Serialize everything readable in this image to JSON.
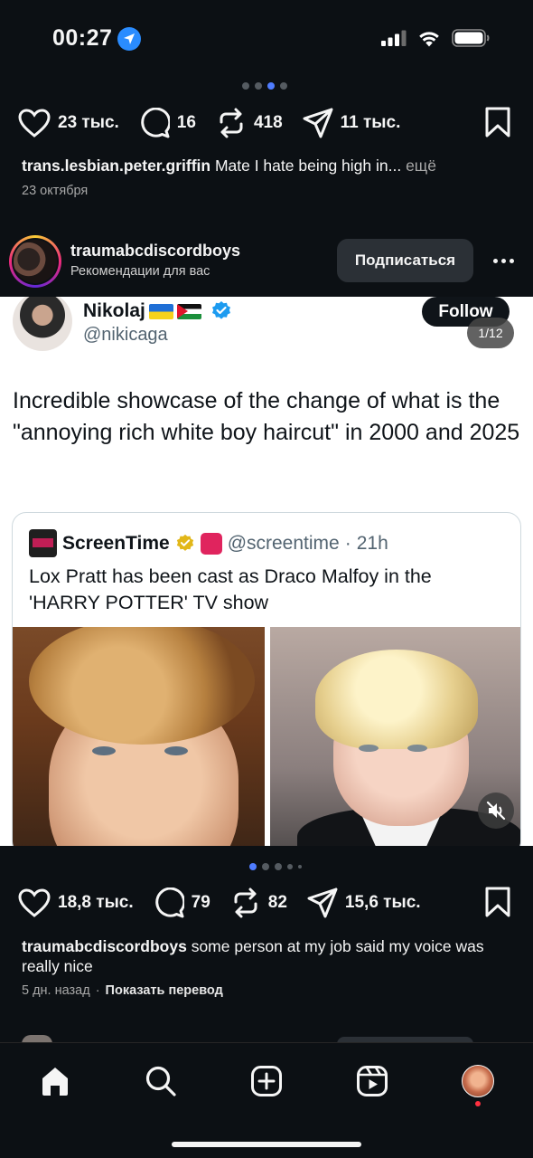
{
  "status": {
    "time": "00:27",
    "icons": [
      "location-arrow-icon",
      "cellular-signal-icon",
      "wifi-icon",
      "battery-icon"
    ]
  },
  "prev_post": {
    "carousel_dots": 4,
    "carousel_active_index": 2,
    "actions": {
      "likes": "23 тыс.",
      "comments": "16",
      "reposts": "418",
      "shares": "11 тыс."
    },
    "caption_user": "trans.lesbian.peter.griffin",
    "caption_text": " Mate I hate being high in...",
    "caption_more": " ещё",
    "date": "23 октября"
  },
  "post": {
    "username": "traumabcdiscordboys",
    "subtitle": "Рекомендации для вас",
    "follow_label": "Подписаться",
    "page_indicator": "1/12",
    "media_tweet": {
      "name": "Nikolaj",
      "handle": "@nikicaga",
      "follow_label": "Follow",
      "text": "Incredible showcase of the change of what is the \"annoying rich white boy haircut\" in 2000 and 2025",
      "quote": {
        "name": "ScreenTime",
        "handle": "@screentime",
        "separator": "·",
        "time": "21h",
        "text": "Lox Pratt has been cast as Draco Malfoy in the 'HARRY POTTER' TV show"
      }
    },
    "carousel_dots": 5,
    "carousel_active_index": 0,
    "actions": {
      "likes": "18,8 тыс.",
      "comments": "79",
      "reposts": "82",
      "shares": "15,6 тыс."
    },
    "caption_user": "traumabcdiscordboys",
    "caption_text": " some person at my job said my voice was really nice",
    "date": "5 дн. назад",
    "meta_separator": "·",
    "translate_label": "Показать перевод"
  },
  "tab_bar": {
    "tabs": [
      "home-icon",
      "search-icon",
      "create-icon",
      "reels-icon",
      "profile-avatar"
    ],
    "active": "home-icon",
    "notification_dot_color": "#ff3040"
  },
  "colors": {
    "background": "#0c1014",
    "accent_dot": "#4f7cff",
    "verified_blue": "#1d9bf0",
    "verified_gold": "#e2b719"
  }
}
